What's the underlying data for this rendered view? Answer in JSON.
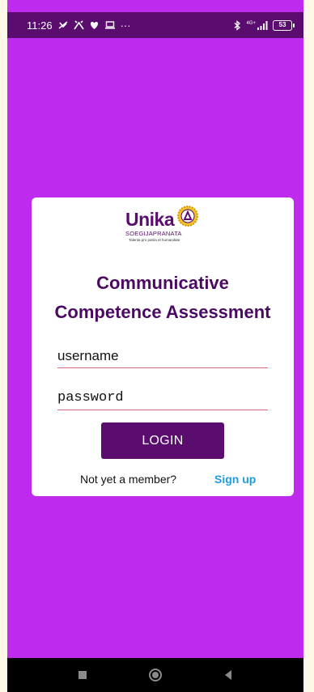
{
  "status_bar": {
    "time": "11:26",
    "more": "···",
    "network": "4G+",
    "battery": "53"
  },
  "logo": {
    "name": "Unika",
    "subtitle": "SOEGIJAPRANATA",
    "tagline": "Talenta pro patria et humanitate"
  },
  "title": {
    "line1": "Communicative",
    "line2": "Competence Assessment"
  },
  "form": {
    "username_placeholder": "username",
    "password_placeholder": "password",
    "login_label": "LOGIN"
  },
  "signup": {
    "prompt": "Not yet a member?",
    "link": "Sign up"
  },
  "colors": {
    "background": "#bf2bee",
    "primary": "#5a0d6e",
    "link": "#1e9be0"
  }
}
